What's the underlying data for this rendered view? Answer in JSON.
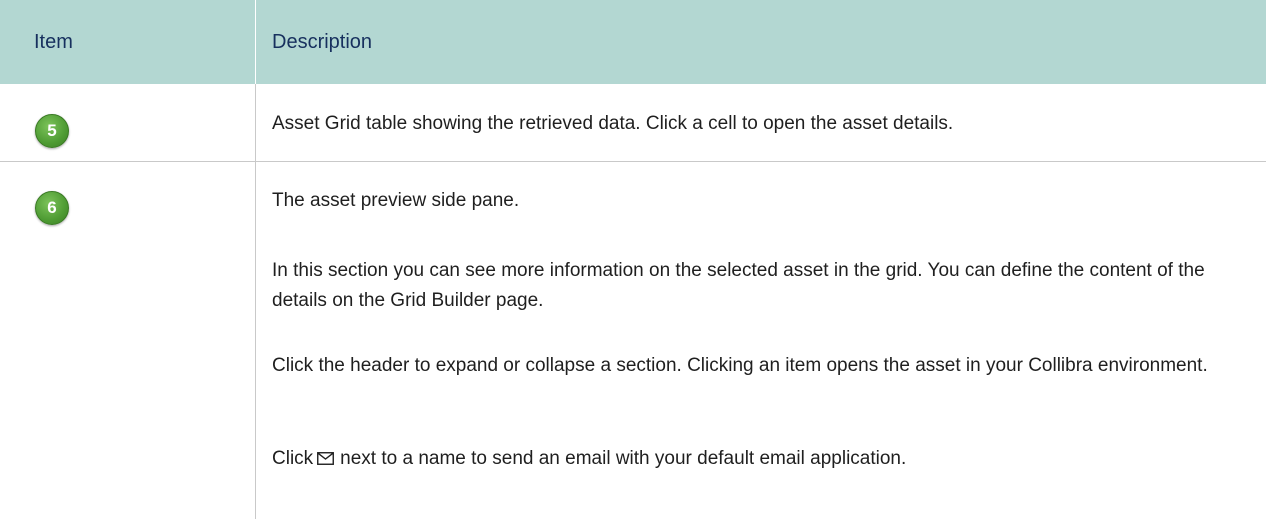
{
  "table": {
    "header": {
      "item": "Item",
      "description": "Description"
    },
    "rows": [
      {
        "badge": "5",
        "paragraphs": [
          "Asset Grid table showing the retrieved data. Click a cell to open the asset details."
        ]
      },
      {
        "badge": "6",
        "paragraphs": [
          "The asset preview side pane.",
          "In this section you can see more information on the selected asset in the grid. You can define the content of the details on the Grid Builder page.",
          "Click the header to expand or collapse a section. Clicking an item opens the asset in your Collibra environment."
        ],
        "email_line": {
          "before": "Click",
          "icon": "envelope-icon",
          "after": "next to a name to send an email with your default email application."
        }
      }
    ]
  },
  "colors": {
    "header_background": "#b3d7d2",
    "header_text": "#17305e",
    "badge_green": "#4e9b33",
    "divider": "#c9c9c9"
  }
}
